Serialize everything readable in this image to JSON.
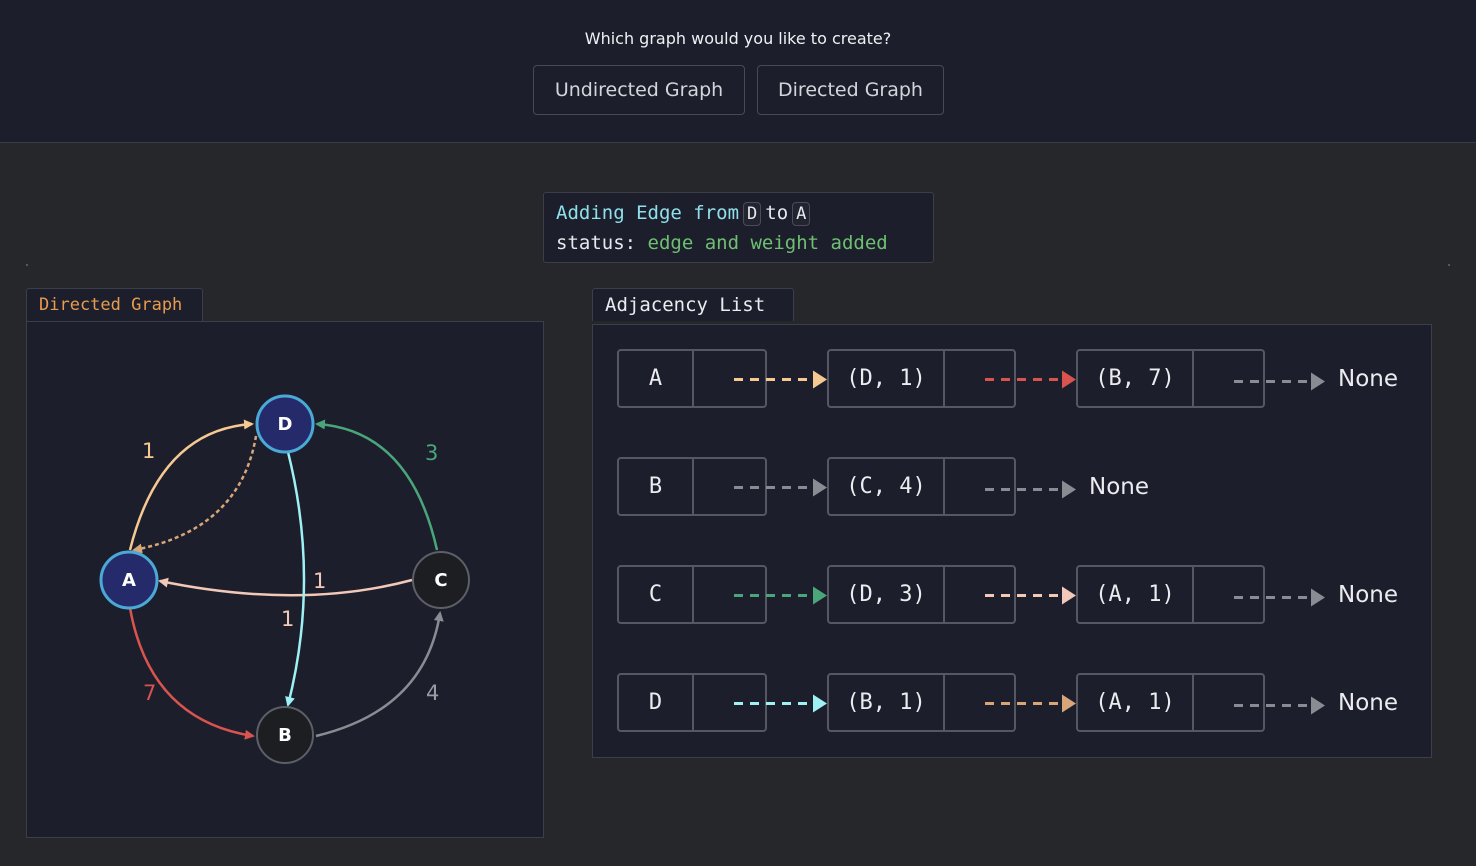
{
  "header": {
    "question": "Which graph would you like to create?",
    "buttons": [
      "Undirected Graph",
      "Directed Graph"
    ]
  },
  "status": {
    "prefix": "Adding Edge from",
    "from": "D",
    "to_word": "to",
    "to": "A",
    "status_label": "status:",
    "status_value": "edge and weight added"
  },
  "graph_panel": {
    "title": "Directed Graph",
    "nodes": [
      {
        "id": "D",
        "state": "active"
      },
      {
        "id": "A",
        "state": "active"
      },
      {
        "id": "C",
        "state": "default"
      },
      {
        "id": "B",
        "state": "default"
      }
    ],
    "edges": [
      {
        "from": "A",
        "to": "D",
        "weight": "1",
        "color": "#f6c993"
      },
      {
        "from": "D",
        "to": "A",
        "weight": "",
        "color": "#d8a57a",
        "style": "dashed"
      },
      {
        "from": "C",
        "to": "D",
        "weight": "3",
        "color": "#4aa57a"
      },
      {
        "from": "C",
        "to": "A",
        "weight": "1",
        "color": "#f2c8b8"
      },
      {
        "from": "D",
        "to": "B",
        "weight": "1",
        "color": "#9ef0f5"
      },
      {
        "from": "A",
        "to": "B",
        "weight": "7",
        "color": "#d9534f"
      },
      {
        "from": "B",
        "to": "C",
        "weight": "4",
        "color": "#8a8c94"
      }
    ],
    "colors": {
      "active_fill": "#252a6b",
      "active_stroke": "#4aa9d6",
      "default_fill": "#1d1e22",
      "default_stroke": "#5c5f68"
    }
  },
  "adjacency": {
    "title": "Adjacency List",
    "none_label": "None",
    "rows": [
      {
        "vertex": "A",
        "arrow_color": "#f6c993",
        "items": [
          {
            "label": "(D, 1)",
            "arrow_color": "#d9534f"
          },
          {
            "label": "(B, 7)",
            "arrow_color": "#8a8c94"
          }
        ]
      },
      {
        "vertex": "B",
        "arrow_color": "#8a8c94",
        "items": [
          {
            "label": "(C, 4)",
            "arrow_color": "#8a8c94"
          }
        ]
      },
      {
        "vertex": "C",
        "arrow_color": "#4aa57a",
        "items": [
          {
            "label": "(D, 3)",
            "arrow_color": "#f2c8b8"
          },
          {
            "label": "(A, 1)",
            "arrow_color": "#8a8c94"
          }
        ]
      },
      {
        "vertex": "D",
        "arrow_color": "#9ef0f5",
        "items": [
          {
            "label": "(B, 1)",
            "arrow_color": "#d8a57a"
          },
          {
            "label": "(A, 1)",
            "arrow_color": "#8a8c94"
          }
        ]
      }
    ]
  }
}
